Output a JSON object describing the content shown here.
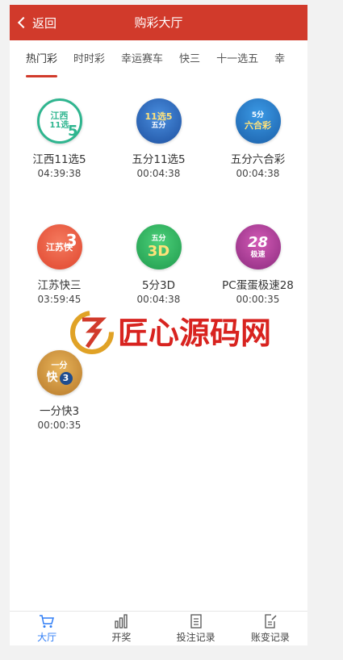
{
  "header": {
    "back_label": "返回",
    "title": "购彩大厅"
  },
  "tabs": [
    "热门彩",
    "时时彩",
    "幸运赛车",
    "快三",
    "十一选五",
    "幸"
  ],
  "games": [
    {
      "name": "江西11选5",
      "time": "04:39:38",
      "logo": {
        "line1": "江西",
        "line2": "11选",
        "big": "5"
      }
    },
    {
      "name": "五分11选5",
      "time": "00:04:38",
      "logo": {
        "line1": "11选5",
        "line2": "五分",
        "big": ""
      }
    },
    {
      "name": "五分六合彩",
      "time": "00:04:38",
      "logo": {
        "line1": "5分",
        "line2": "六合彩",
        "big": ""
      }
    },
    {
      "name": "江苏快三",
      "time": "03:59:45",
      "logo": {
        "line1": "江苏快",
        "line2": "",
        "big": "3"
      }
    },
    {
      "name": "5分3D",
      "time": "00:04:38",
      "logo": {
        "line1": "五分",
        "line2": "",
        "big": "3D"
      }
    },
    {
      "name": "PC蛋蛋极速28",
      "time": "00:00:35",
      "logo": {
        "line1": "28",
        "line2": "极速",
        "big": ""
      }
    },
    {
      "name": "一分快3",
      "time": "00:00:35",
      "logo": {
        "line1": "一分",
        "line2": "快",
        "big": "3"
      }
    }
  ],
  "watermark": {
    "text": "匠心源码网"
  },
  "bottom_nav": [
    {
      "label": "大厅",
      "icon": "cart-icon"
    },
    {
      "label": "开奖",
      "icon": "bar-chart-icon"
    },
    {
      "label": "投注记录",
      "icon": "document-icon"
    },
    {
      "label": "账变记录",
      "icon": "edit-document-icon"
    }
  ],
  "colors": {
    "accent": "#d13a2b",
    "active_nav": "#2f7df6"
  }
}
